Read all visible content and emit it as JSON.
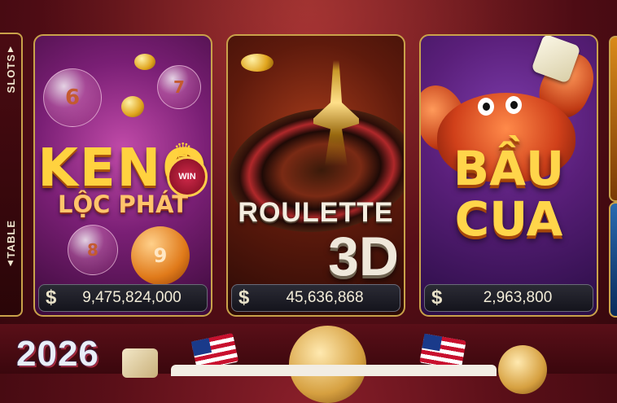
{
  "side_tabs": [
    {
      "label": "SLOTS"
    },
    {
      "label": "TABLE"
    }
  ],
  "games": [
    {
      "title_line1": "KENO",
      "title_line2": "LỘC PHÁT",
      "badge": "WIN",
      "ball_numbers": [
        "6",
        "7",
        "8",
        "9"
      ],
      "currency_symbol": "$",
      "jackpot": "9,475,824,000"
    },
    {
      "title_line1": "ROULETTE",
      "title_line2": "3D",
      "currency_symbol": "$",
      "jackpot": "45,636,868"
    },
    {
      "title_line1": "BẦU",
      "title_line2": "CUA",
      "currency_symbol": "$",
      "jackpot": "2,963,800"
    }
  ],
  "banner": {
    "year": "2026"
  },
  "colors": {
    "gold_border": "#c9a24a",
    "background": "#5a0f18",
    "title_gold": "#ffd23f"
  }
}
